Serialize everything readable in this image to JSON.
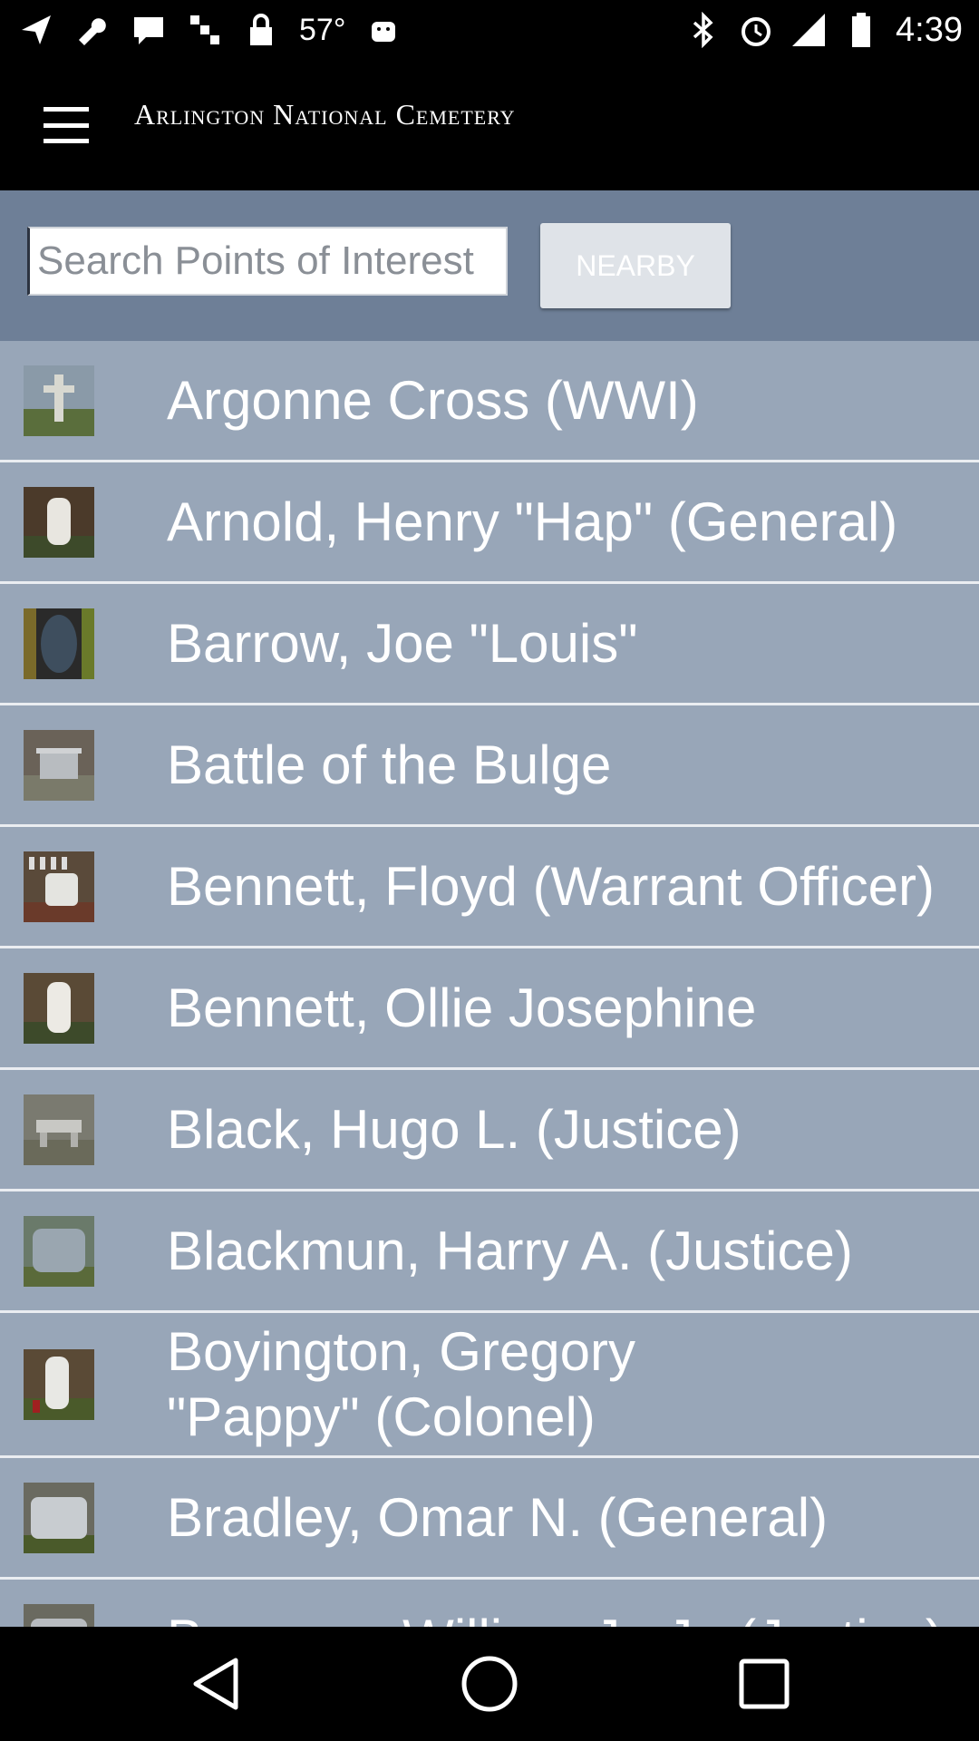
{
  "status_bar": {
    "temperature": "57°",
    "time": "4:39",
    "icons": [
      "location-arrow-icon",
      "wrench-icon",
      "message-icon",
      "satellite-icon",
      "lock-icon",
      "android-icon",
      "bluetooth-icon",
      "alarm-icon",
      "signal-icon",
      "battery-icon"
    ]
  },
  "app_bar": {
    "menu_icon": "hamburger-menu-icon",
    "title": "Arlington National Cemetery"
  },
  "search": {
    "placeholder": "Search Points of Interest",
    "value": "",
    "nearby_label": "NEARBY"
  },
  "list": {
    "items": [
      {
        "label": "Argonne Cross (WWI)",
        "thumb": "cross-monument"
      },
      {
        "label": "Arnold, Henry \"Hap\" (General)",
        "thumb": "headstone"
      },
      {
        "label": "Barrow, Joe \"Louis\"",
        "thumb": "plaque"
      },
      {
        "label": "Battle of the Bulge",
        "thumb": "memorial"
      },
      {
        "label": "Bennett, Floyd (Warrant Officer)",
        "thumb": "headstones-field"
      },
      {
        "label": "Bennett, Ollie Josephine",
        "thumb": "headstone"
      },
      {
        "label": "Black, Hugo L. (Justice)",
        "thumb": "bench-stone"
      },
      {
        "label": "Blackmun, Harry A. (Justice)",
        "thumb": "gravestone-wide"
      },
      {
        "label": "Boyington, Gregory \"Pappy\" (Colonel)",
        "thumb": "headstone-flag"
      },
      {
        "label": "Bradley, Omar N. (General)",
        "thumb": "gravestone-wide"
      },
      {
        "label": "Brennan, William J., Jr. (Justice)",
        "thumb": "gravestone-wide"
      }
    ]
  },
  "colors": {
    "search_bar_bg": "#6e7f97",
    "list_bg": "#98a6b8",
    "divider": "#eaedf1"
  },
  "nav_bar": {
    "icons": [
      "back-icon",
      "home-icon",
      "recents-icon"
    ]
  }
}
